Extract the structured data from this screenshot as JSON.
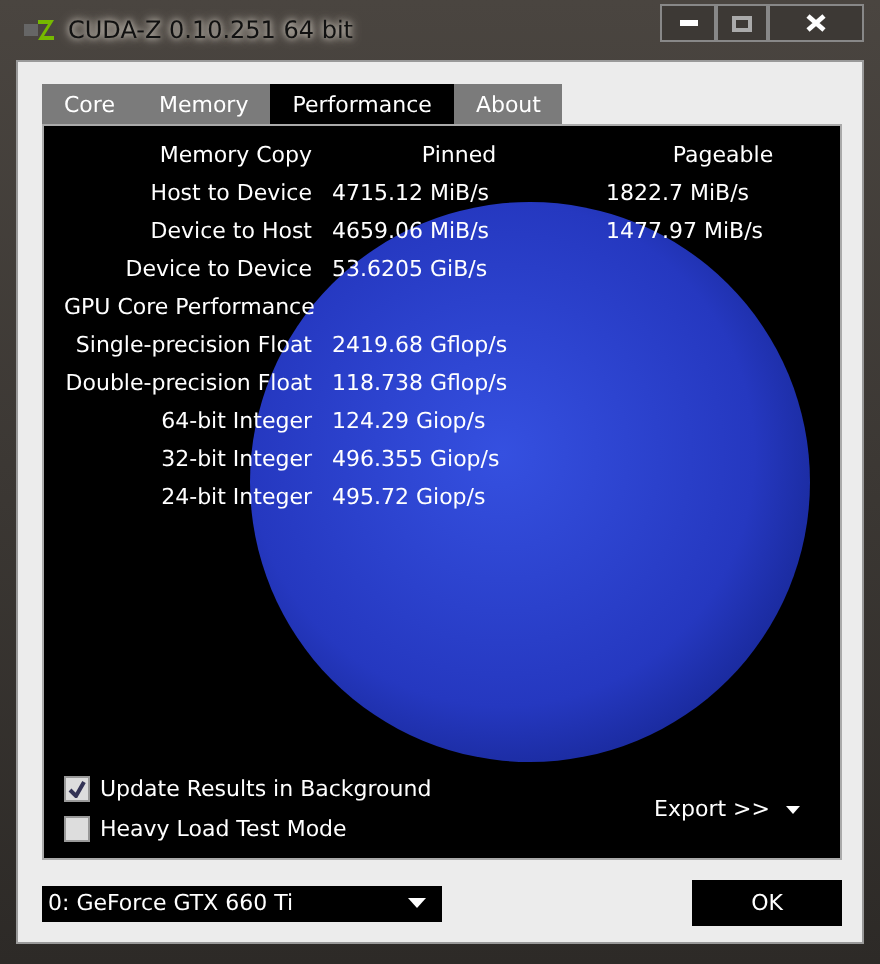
{
  "window": {
    "title": "CUDA-Z 0.10.251 64 bit"
  },
  "tabs": [
    {
      "label": "Core",
      "selected": false
    },
    {
      "label": "Memory",
      "selected": false
    },
    {
      "label": "Performance",
      "selected": true
    },
    {
      "label": "About",
      "selected": false
    }
  ],
  "header": {
    "label": "Memory Copy",
    "column_1": "Pinned",
    "column_2": "Pageable"
  },
  "rows": [
    {
      "label": "Host to Device",
      "pinned": "4715.12 MiB/s",
      "pageable": "1822.7 MiB/s"
    },
    {
      "label": "Device to Host",
      "pinned": "4659.06 MiB/s",
      "pageable": "1477.97 MiB/s"
    },
    {
      "label": "Device to Device",
      "pinned": "53.6205 GiB/s"
    },
    {
      "label": "GPU Core Performance"
    },
    {
      "label": "Single-precision Float",
      "pinned": "2419.68 Gflop/s"
    },
    {
      "label": "Double-precision Float",
      "pinned": "118.738 Gflop/s"
    },
    {
      "label": "64-bit Integer",
      "pinned": "124.29 Giop/s"
    },
    {
      "label": "32-bit Integer",
      "pinned": "496.355 Giop/s"
    },
    {
      "label": "24-bit Integer",
      "pinned": "495.72 Giop/s"
    }
  ],
  "options": [
    {
      "label": "Update Results in Background",
      "checked": true
    },
    {
      "label": "Heavy Load Test Mode",
      "checked": false
    }
  ],
  "export_button": "Export >>",
  "device_select": {
    "value": "0: GeForce GTX 660 Ti"
  },
  "ok_button": "OK"
}
